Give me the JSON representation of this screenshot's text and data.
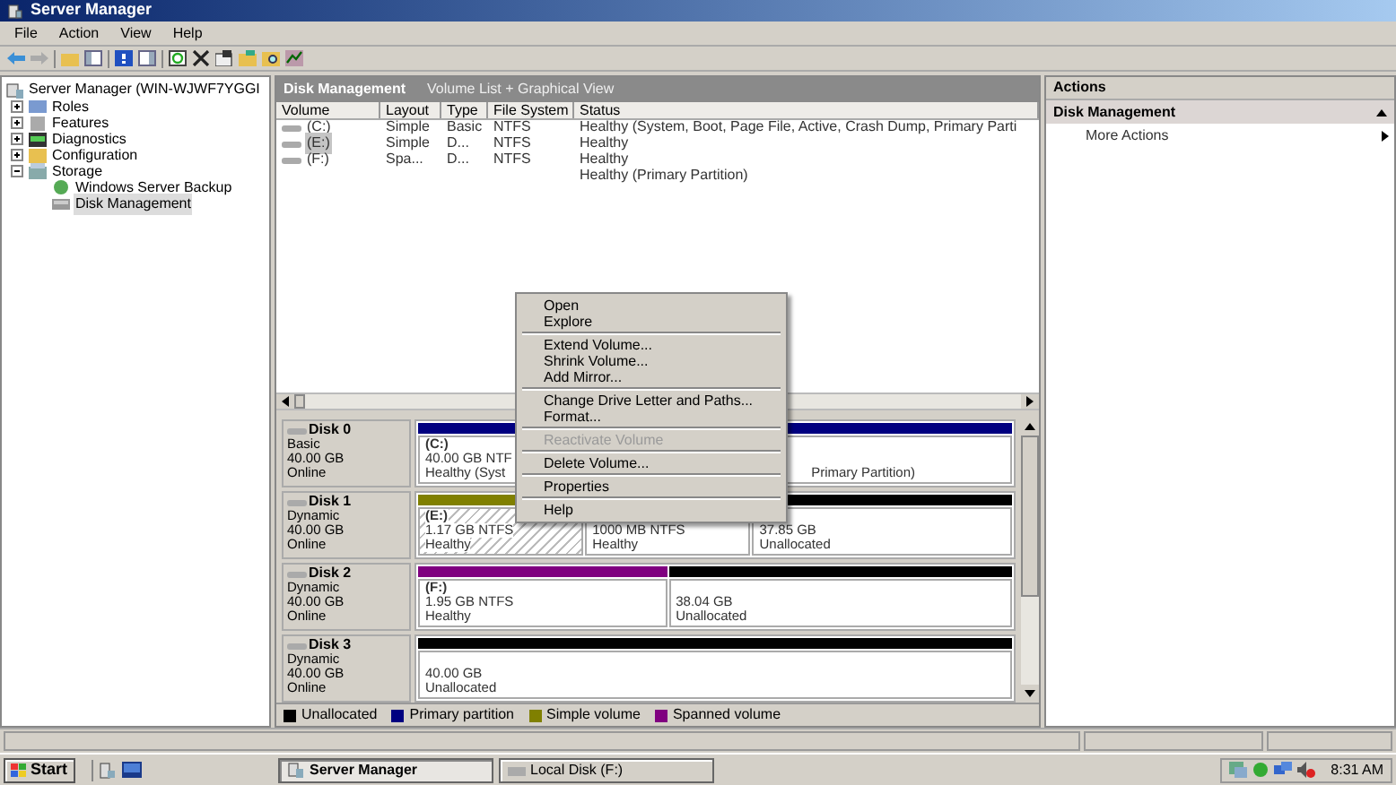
{
  "window": {
    "title": "Server Manager"
  },
  "menu_bar": [
    "File",
    "Action",
    "View",
    "Help"
  ],
  "tree": {
    "root": "Server Manager (WIN-WJWF7YGGI",
    "children": [
      {
        "label": "Roles",
        "expanded": false
      },
      {
        "label": "Features",
        "expanded": false
      },
      {
        "label": "Diagnostics",
        "expanded": false
      },
      {
        "label": "Configuration",
        "expanded": false
      },
      {
        "label": "Storage",
        "expanded": true,
        "children": [
          {
            "label": "Windows Server Backup",
            "selected": false
          },
          {
            "label": "Disk Management",
            "selected": true
          }
        ]
      }
    ]
  },
  "center": {
    "title": "Disk Management",
    "subtitle": "Volume List + Graphical View"
  },
  "volume_table": {
    "columns": [
      "Volume",
      "Layout",
      "Type",
      "File System",
      "Status"
    ],
    "rows": [
      {
        "cells": [
          "(C:)",
          "Simple",
          "Basic",
          "NTFS",
          "Healthy (System, Boot, Page File, Active, Crash Dump, Primary Parti"
        ],
        "selected": false
      },
      {
        "cells": [
          "(E:)",
          "Simple",
          "D...",
          "NTFS",
          "Healthy"
        ],
        "selected": true
      },
      {
        "cells": [
          "(F:)",
          "Spa...",
          "D...",
          "NTFS",
          "Healthy"
        ],
        "selected": false
      },
      {
        "cells": [
          "",
          "",
          "",
          "",
          "Healthy (Primary Partition)"
        ],
        "selected": false
      }
    ]
  },
  "disks": [
    {
      "name": "Disk 0",
      "type": "Basic",
      "size": "40.00 GB",
      "status": "Online",
      "partitions": [
        {
          "color": "#000080",
          "name": "(C:)",
          "size": "40.00 GB NTF",
          "status": "Healthy (Syst",
          "status_tail": "Primary Partition)",
          "selected": false
        }
      ]
    },
    {
      "name": "Disk 1",
      "type": "Dynamic",
      "size": "40.00 GB",
      "status": "Online",
      "partitions": [
        {
          "color": "#808000",
          "name": "(E:)",
          "size": "1.17 GB NTFS",
          "status": "Healthy",
          "selected": true
        },
        {
          "size": "1000 MB NTFS",
          "status": "Healthy",
          "selected": false
        },
        {
          "color": "#000000",
          "size": "37.85 GB",
          "status": "Unallocated",
          "selected": false
        }
      ]
    },
    {
      "name": "Disk 2",
      "type": "Dynamic",
      "size": "40.00 GB",
      "status": "Online",
      "partitions": [
        {
          "color": "#800080",
          "name": "(F:)",
          "size": "1.95 GB NTFS",
          "status": "Healthy",
          "selected": false
        },
        {
          "color": "#000000",
          "size": "38.04 GB",
          "status": "Unallocated",
          "selected": false
        }
      ]
    },
    {
      "name": "Disk 3",
      "type": "Dynamic",
      "size": "40.00 GB",
      "status": "Online",
      "partitions": [
        {
          "color": "#000000",
          "size": "40.00 GB",
          "status": "Unallocated",
          "selected": false
        }
      ]
    }
  ],
  "legend": [
    {
      "label": "Unallocated",
      "color": "#000000"
    },
    {
      "label": "Primary partition",
      "color": "#000080"
    },
    {
      "label": "Simple volume",
      "color": "#808000"
    },
    {
      "label": "Spanned volume",
      "color": "#800080"
    }
  ],
  "context_menu": [
    {
      "kind": "item",
      "label": "Open",
      "disabled": false
    },
    {
      "kind": "item",
      "label": "Explore",
      "disabled": false
    },
    {
      "kind": "separator"
    },
    {
      "kind": "item",
      "label": "Extend Volume...",
      "disabled": false
    },
    {
      "kind": "item",
      "label": "Shrink Volume...",
      "disabled": false
    },
    {
      "kind": "item",
      "label": "Add Mirror...",
      "disabled": false
    },
    {
      "kind": "separator"
    },
    {
      "kind": "item",
      "label": "Change Drive Letter and Paths...",
      "disabled": false
    },
    {
      "kind": "item",
      "label": "Format...",
      "disabled": false
    },
    {
      "kind": "separator"
    },
    {
      "kind": "item",
      "label": "Reactivate Volume",
      "disabled": true
    },
    {
      "kind": "separator"
    },
    {
      "kind": "item",
      "label": "Delete Volume...",
      "disabled": false
    },
    {
      "kind": "separator"
    },
    {
      "kind": "item",
      "label": "Properties",
      "disabled": false
    },
    {
      "kind": "separator"
    },
    {
      "kind": "item",
      "label": "Help",
      "disabled": false
    }
  ],
  "actions": {
    "title": "Actions",
    "section": "Disk Management",
    "items": [
      "More Actions"
    ]
  },
  "taskbar": {
    "start": "Start",
    "tasks": [
      {
        "label": "Server Manager",
        "selected": true
      },
      {
        "label": "Local Disk (F:)",
        "selected": false
      }
    ],
    "time": "8:31 AM"
  }
}
